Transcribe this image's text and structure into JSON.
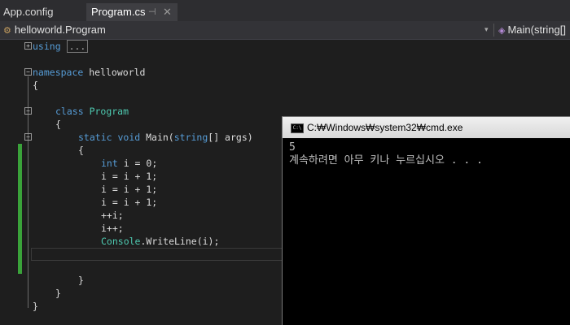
{
  "tabs": [
    {
      "label": "App.config",
      "active": false
    },
    {
      "label": "Program.cs",
      "active": true,
      "pin_icon": "pin-icon",
      "close_icon": "close-icon"
    }
  ],
  "navbar": {
    "class_icon": "class-icon",
    "class_label": "helloworld.Program",
    "member_icon": "method-icon",
    "member_label": "Main(string[]"
  },
  "code": {
    "using_kw": "using",
    "using_collapsed": "...",
    "namespace_kw": "namespace",
    "namespace_name": " helloworld",
    "brace_open": "{",
    "brace_close": "}",
    "class_kw": "class",
    "class_name": "Program",
    "static_kw": "static",
    "void_kw": "void",
    "main_sig": " Main(",
    "string_kw": "string",
    "args": "[] args)",
    "int_kw": "int",
    "l1": " i = 0;",
    "l2": "i = i + 1;",
    "l3": "i = i + 1;",
    "l4": "i = i + 1;",
    "l5": "++i;",
    "l6": "i++;",
    "console_type": "Console",
    "writeline": ".WriteLine(i);"
  },
  "colors": {
    "keyword": "#569cd6",
    "type": "#4ec9b0",
    "change_bar": "#3aa23a"
  },
  "console": {
    "title": "C:\\Windows\\system32\\cmd.exe",
    "title_display": "C:₩Windows₩system32₩cmd.exe",
    "output_line1": "5",
    "output_line2": "계속하려면 아무 키나 누르십시오 . . ."
  }
}
